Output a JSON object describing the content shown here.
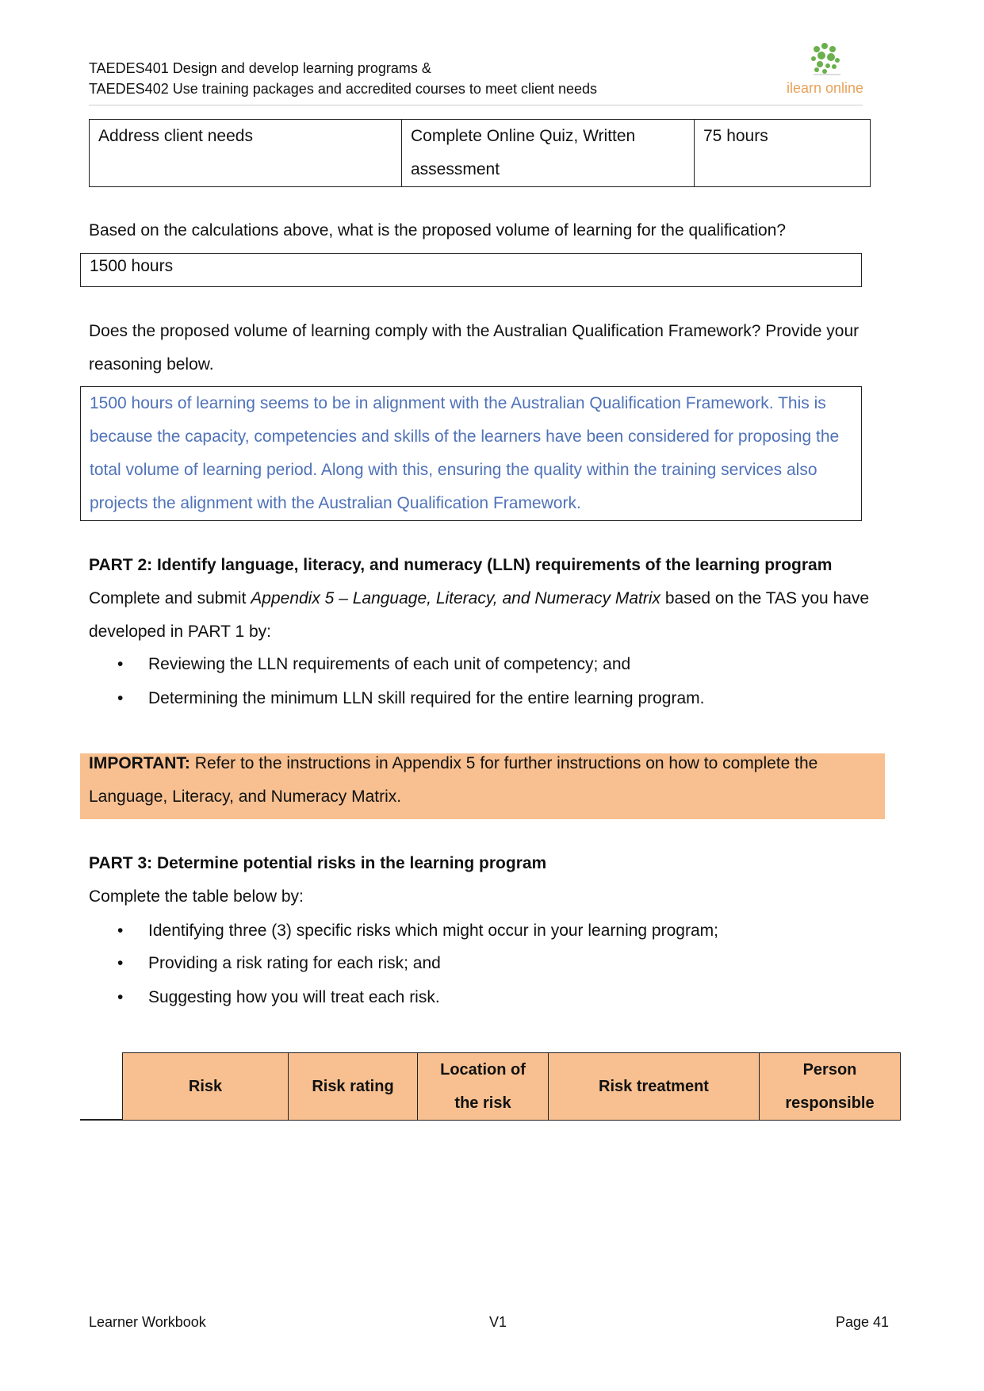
{
  "header": {
    "line1": "TAEDES401 Design and develop learning programs &",
    "line2": "TAEDES402 Use training packages and accredited courses to meet client needs",
    "logo_text": "ilearn online",
    "logo_colors": {
      "dots": "#6ab04c",
      "text": "#e8a25a"
    }
  },
  "top_table": {
    "row": [
      "Address client needs",
      "Complete Online Quiz, Written",
      "assessment",
      "75 hours"
    ]
  },
  "question1": {
    "text": "Based on the calculations above, what is the proposed volume of learning for the qualification?",
    "answer": "1500 hours"
  },
  "question2": {
    "line1": "Does the proposed volume of learning comply with the Australian Qualification Framework? Provide your",
    "line2": "reasoning below.",
    "answer_lines": [
      "1500 hours of learning seems to be in alignment with the Australian Qualification Framework. This is",
      "because the capacity, competencies and skills of the learners have been considered for proposing the",
      "total volume of learning period. Along with this, ensuring the quality within the training services also",
      "projects the alignment with the Australian Qualification Framework."
    ]
  },
  "part2": {
    "heading": "PART 2: Identify language, literacy, and numeracy (LLN) requirements of the learning program",
    "intro_a": "Complete and submit ",
    "intro_italic": "Appendix 5 – Language, Literacy, and Numeracy Matrix",
    "intro_b": " based on the TAS you have",
    "intro_line2": "developed in PART 1 by:",
    "bullets": [
      "Reviewing the LLN requirements of each unit of competency; and",
      "Determining the minimum LLN skill required for the entire learning program."
    ]
  },
  "important": {
    "label": "IMPORTANT:",
    "line1": " Refer to the instructions in Appendix 5 for further instructions on how to complete the",
    "line2": "Language, Literacy, and Numeracy Matrix.",
    "color": "#f8c090"
  },
  "part3": {
    "heading": "PART 3: Determine potential risks in the learning program",
    "intro": "Complete the table below by:",
    "bullets": [
      "Identifying three (3) specific risks which might occur in your learning program;",
      "Providing a risk rating for each risk; and",
      "Suggesting how you will treat each risk."
    ],
    "table_headers": [
      "Risk",
      "Risk rating",
      "Location of",
      "the risk",
      "Risk treatment",
      "Person",
      "responsible"
    ]
  },
  "footer": {
    "left": "Learner Workbook",
    "center": "V1",
    "right": "Page 41"
  }
}
